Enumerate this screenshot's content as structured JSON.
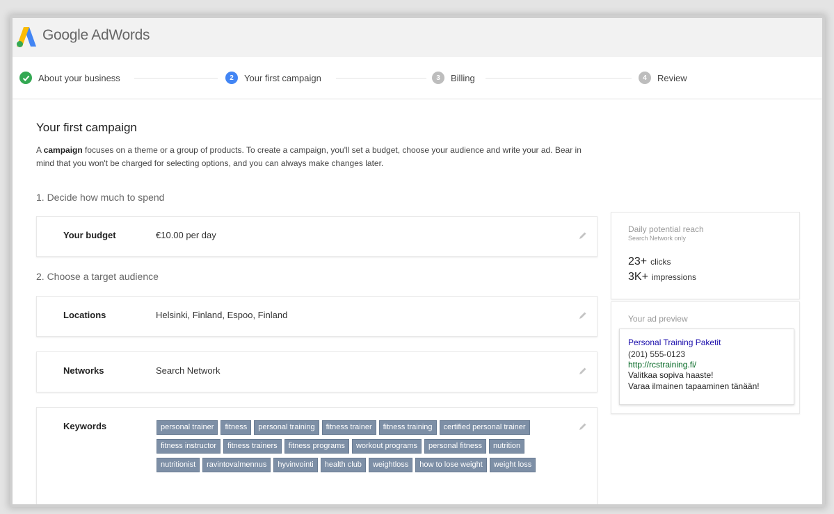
{
  "header": {
    "brand": "Google AdWords"
  },
  "steps": [
    {
      "label": "About your business",
      "status": "complete",
      "marker": ""
    },
    {
      "label": "Your first campaign",
      "status": "current",
      "marker": "2"
    },
    {
      "label": "Billing",
      "status": "upcoming",
      "marker": "3"
    },
    {
      "label": "Review",
      "status": "upcoming",
      "marker": "4"
    }
  ],
  "page": {
    "title": "Your first campaign",
    "intro_bold": "campaign",
    "intro_prefix": "A ",
    "intro_rest": " focuses on a theme or a group of products. To create a campaign, you'll set a budget, choose your audience and write your ad. Bear in mind that you won't be charged for selecting options, and you can always make changes later."
  },
  "section1": {
    "heading": "1. Decide how much to spend"
  },
  "budget": {
    "label": "Your budget",
    "value": "€10.00 per day"
  },
  "section2": {
    "heading": "2. Choose a target audience"
  },
  "locations": {
    "label": "Locations",
    "value": "Helsinki, Finland, Espoo, Finland"
  },
  "networks": {
    "label": "Networks",
    "value": "Search Network"
  },
  "keywords": {
    "label": "Keywords",
    "items": [
      "personal trainer",
      "fitness",
      "personal training",
      "fitness trainer",
      "fitness training",
      "certified personal trainer",
      "fitness instructor",
      "fitness trainers",
      "fitness programs",
      "workout programs",
      "personal fitness",
      "nutrition",
      "nutritionist",
      "ravintovalmennus",
      "hyvinvointi",
      "health club",
      "weightloss",
      "how to lose weight",
      "weight loss"
    ]
  },
  "reach": {
    "title": "Daily potential reach",
    "subtitle": "Search Network only",
    "clicks_value": "23+",
    "clicks_unit": "clicks",
    "impressions_value": "3K+",
    "impressions_unit": "impressions"
  },
  "ad_preview": {
    "title": "Your ad preview",
    "headline": "Personal Training Paketit",
    "phone": "(201) 555-0123",
    "url": "http://rcstraining.fi/",
    "line1": "Valitkaa sopiva haaste!",
    "line2": "Varaa ilmainen tapaaminen tänään!"
  },
  "colors": {
    "logo_blue": "#4285f4",
    "logo_yellow": "#fbbc05",
    "logo_green": "#34a853",
    "step_complete": "#34a853",
    "step_current": "#4285f4",
    "step_upcoming": "#bdbdbd",
    "keyword_chip": "#7d8fa6",
    "ad_headline": "#1a0dab",
    "ad_url": "#006621"
  }
}
